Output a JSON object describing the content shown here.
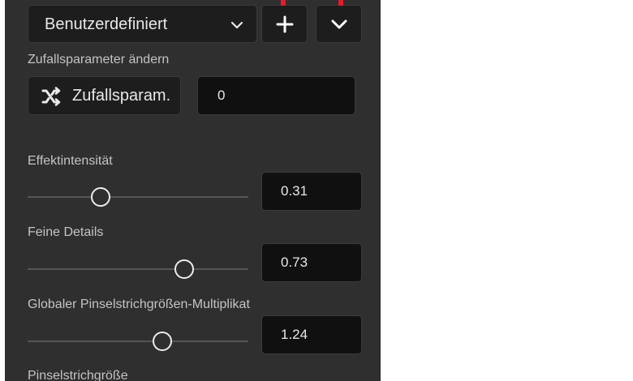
{
  "preset": {
    "selected": "Benutzerdefiniert",
    "add_icon": "plus-icon",
    "menu_icon": "chevron-down-icon"
  },
  "random": {
    "section_label": "Zufallsparameter ändern",
    "button_label": "Zufallsparam.",
    "button_icon": "shuffle-icon",
    "value": "0"
  },
  "sliders": [
    {
      "label": "Effektintensität",
      "value": "0.31",
      "position": 0.33
    },
    {
      "label": "Feine Details",
      "value": "0.73",
      "position": 0.71
    },
    {
      "label": "Globaler Pinselstrichgrößen-Multiplikator",
      "value": "1.24",
      "position": 0.61
    }
  ],
  "next_section_label": "Pinselstrichgröße",
  "colors": {
    "panel": "#2f2f2f",
    "control": "#1d1d1d",
    "input": "#101010",
    "marker": "#e8192c"
  }
}
